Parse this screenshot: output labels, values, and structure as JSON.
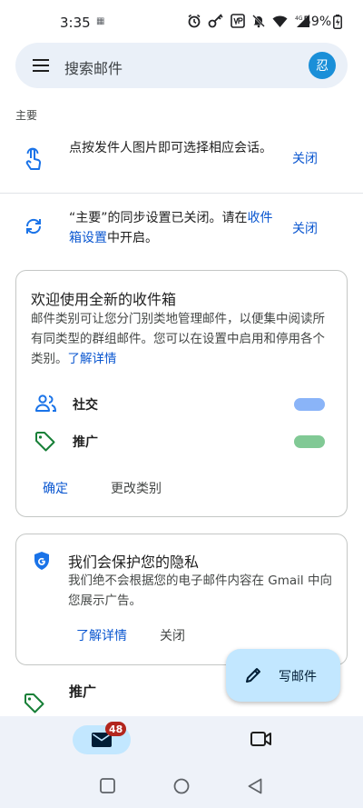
{
  "status_bar": {
    "time": "3:35",
    "indicator": "▦",
    "battery_percent": "59%",
    "icons": [
      "alarm-icon",
      "key-icon",
      "vpn-icon",
      "bell-off-icon",
      "wifi-icon",
      "signal-4g-icon",
      "battery-icon"
    ]
  },
  "search": {
    "placeholder": "搜索邮件",
    "avatar_initial": "忍"
  },
  "section": {
    "label": "主要"
  },
  "tips": [
    {
      "text": "点按发件人图片即可选择相应会话。",
      "close": "关闭"
    },
    {
      "text_before": "“主要”的同步设置已关闭。请在",
      "link": "收件箱设置",
      "text_after": "中开启。",
      "close": "关闭"
    }
  ],
  "welcome_card": {
    "title": "欢迎使用全新的收件箱",
    "body": "邮件类别可让您分门别类地管理邮件，以便集中阅读所有同类型的群组邮件。您可以在设置中启用和停用各个类别。",
    "learn_more": "了解详情",
    "categories": [
      {
        "label": "社交",
        "icon": "people-icon",
        "toggle_color": "#8ab4f8"
      },
      {
        "label": "推广",
        "icon": "tag-icon",
        "toggle_color": "#81c995"
      }
    ],
    "confirm": "确定",
    "change": "更改类别"
  },
  "privacy_card": {
    "title": "我们会保护您的隐私",
    "body": "我们绝不会根据您的电子邮件内容在 Gmail 中向您展示广告。",
    "learn_more": "了解详情",
    "close": "关闭"
  },
  "promo_row": {
    "label": "推广"
  },
  "fab": {
    "label": "写邮件"
  },
  "bottom_nav": {
    "mail_badge": "48"
  },
  "colors": {
    "accent": "#0b57d0",
    "search_bg": "#eaf0f8",
    "fab_bg": "#c2e7ff",
    "badge": "#b3261e",
    "promo_green": "#188038"
  }
}
